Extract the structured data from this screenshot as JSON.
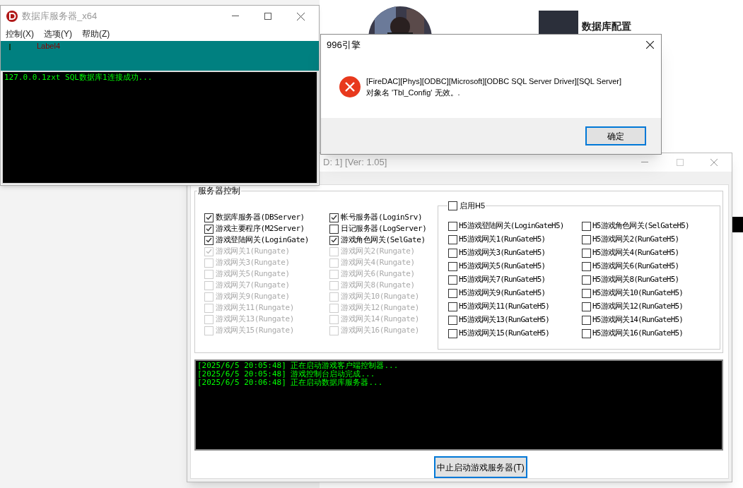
{
  "background_page": {
    "heading": "数据库配置"
  },
  "db_window": {
    "title": "数据库服务器_x64",
    "menu": [
      "控制(X)",
      "选项(Y)",
      "帮助(Z)"
    ],
    "label": "Label4",
    "log": [
      "127.0.0.1zxt SQL数据库1连接成功..."
    ]
  },
  "dialog": {
    "title": "996引擎",
    "message": [
      "[FireDAC][Phys][ODBC][Microsoft][ODBC SQL Server Driver][SQL Server]",
      "对象名 'Tbl_Config' 无效。."
    ],
    "button": "确定"
  },
  "control_window": {
    "title": "D: 1] [Ver:  1.05]",
    "group_title": "服务器控制",
    "servers": [
      {
        "label": "数据库服务器(DBServer)",
        "checked": true,
        "disabled": false
      },
      {
        "label": "帐号服务器(LoginSrv)",
        "checked": true,
        "disabled": false
      },
      {
        "label": "游戏主要程序(M2Server)",
        "checked": true,
        "disabled": false
      },
      {
        "label": "日记服务器(LogServer)",
        "checked": false,
        "disabled": false
      },
      {
        "label": "游戏登陆网关(LoginGate)",
        "checked": true,
        "disabled": false
      },
      {
        "label": "游戏角色网关(SelGate)",
        "checked": true,
        "disabled": false
      },
      {
        "label": "游戏网关1(Rungate)",
        "checked": true,
        "disabled": true
      },
      {
        "label": "游戏网关2(Rungate)",
        "checked": false,
        "disabled": true
      },
      {
        "label": "游戏网关3(Rungate)",
        "checked": false,
        "disabled": true
      },
      {
        "label": "游戏网关4(Rungate)",
        "checked": false,
        "disabled": true
      },
      {
        "label": "游戏网关5(Rungate)",
        "checked": false,
        "disabled": true
      },
      {
        "label": "游戏网关6(Rungate)",
        "checked": false,
        "disabled": true
      },
      {
        "label": "游戏网关7(Rungate)",
        "checked": false,
        "disabled": true
      },
      {
        "label": "游戏网关8(Rungate)",
        "checked": false,
        "disabled": true
      },
      {
        "label": "游戏网关9(Rungate)",
        "checked": false,
        "disabled": true
      },
      {
        "label": "游戏网关10(Rungate)",
        "checked": false,
        "disabled": true
      },
      {
        "label": "游戏网关11(Rungate)",
        "checked": false,
        "disabled": true
      },
      {
        "label": "游戏网关12(Rungate)",
        "checked": false,
        "disabled": true
      },
      {
        "label": "游戏网关13(Rungate)",
        "checked": false,
        "disabled": true
      },
      {
        "label": "游戏网关14(Rungate)",
        "checked": false,
        "disabled": true
      },
      {
        "label": "游戏网关15(Rungate)",
        "checked": false,
        "disabled": true
      },
      {
        "label": "游戏网关16(Rungate)",
        "checked": false,
        "disabled": true
      }
    ],
    "h5": {
      "label": "启用H5",
      "checked": false,
      "gates": [
        {
          "label": "H5游戏登陆网关(LoginGateH5)",
          "checked": false
        },
        {
          "label": "H5游戏角色网关(SelGateH5)",
          "checked": false
        },
        {
          "label": "H5游戏网关1(RunGateH5)",
          "checked": false
        },
        {
          "label": "H5游戏网关2(RunGateH5)",
          "checked": false
        },
        {
          "label": "H5游戏网关3(RunGateH5)",
          "checked": false
        },
        {
          "label": "H5游戏网关4(RunGateH5)",
          "checked": false
        },
        {
          "label": "H5游戏网关5(RunGateH5)",
          "checked": false
        },
        {
          "label": "H5游戏网关6(RunGateH5)",
          "checked": false
        },
        {
          "label": "H5游戏网关7(RunGateH5)",
          "checked": false
        },
        {
          "label": "H5游戏网关8(RunGateH5)",
          "checked": false
        },
        {
          "label": "H5游戏网关9(RunGateH5)",
          "checked": false
        },
        {
          "label": "H5游戏网关10(RunGateH5)",
          "checked": false
        },
        {
          "label": "H5游戏网关11(RunGateH5)",
          "checked": false
        },
        {
          "label": "H5游戏网关12(RunGateH5)",
          "checked": false
        },
        {
          "label": "H5游戏网关13(RunGateH5)",
          "checked": false
        },
        {
          "label": "H5游戏网关14(RunGateH5)",
          "checked": false
        },
        {
          "label": "H5游戏网关15(RunGateH5)",
          "checked": false
        },
        {
          "label": "H5游戏网关16(RunGateH5)",
          "checked": false
        }
      ]
    },
    "log": [
      "[2025/6/5 20:05:48] 正在启动游戏客户端控制器...",
      "[2025/6/5 20:05:48] 游戏控制台启动完成...",
      "[2025/6/5 20:06:48] 正在启动数据库服务器..."
    ],
    "button": "中止启动游戏服务器(T)"
  }
}
